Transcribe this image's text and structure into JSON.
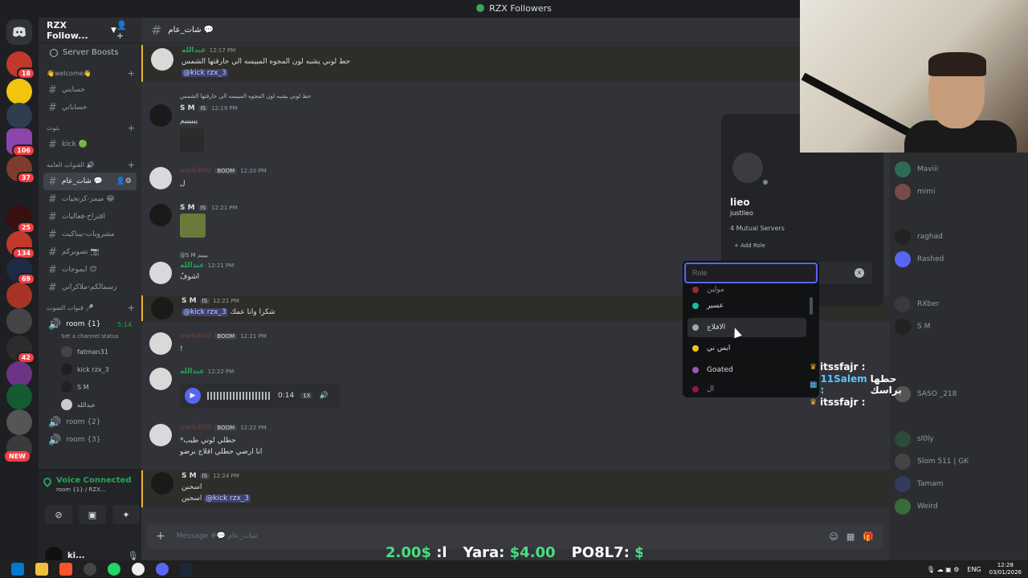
{
  "window": {
    "title": "RZX Followers"
  },
  "server": {
    "name": "RZX Follow...",
    "boost_label": "Server Boosts"
  },
  "rail": {
    "badges": [
      "18",
      "106",
      "37",
      "25",
      "134",
      "69",
      "42"
    ],
    "new_label": "NEW"
  },
  "sidebar": {
    "categories": [
      {
        "label": "👋welcome👋"
      },
      {
        "label": "بثوث"
      },
      {
        "label": "القنوات العامه 🔊"
      },
      {
        "label": "قنوات الصوت 🎤"
      }
    ],
    "channels": [
      {
        "label": "حسابتي"
      },
      {
        "label": "حساباتي"
      },
      {
        "label": "kick 🟢"
      },
      {
        "label": "شات_عام 💬"
      },
      {
        "label": "ميمز-كرنجيات 😂"
      },
      {
        "label": "اقتراح-فعاليات"
      },
      {
        "label": "مشروبات-بيناكيت"
      },
      {
        "label": "تصويركم 📷"
      },
      {
        "label": "ايموجات 😊"
      },
      {
        "label": "رسمالكم-ملاكراتي"
      }
    ],
    "voice_room": {
      "label": "room {1}",
      "timer": "5:14",
      "status": "Set a channel status"
    },
    "voice_users": [
      "fatman31",
      "kick rzx_3",
      "S M",
      "عبدالله"
    ],
    "voice_room2": "room {2}",
    "voice_room3": "room {3}"
  },
  "voice_panel": {
    "title": "Voice Connected",
    "subtitle": "room {1} / RZX..."
  },
  "user_panel": {
    "name": "ki..."
  },
  "chat": {
    "channel_name": "شات_عام 💬",
    "composer_placeholder": "Message #💬 شات_عام",
    "messages": [
      {
        "author": "عبدالله",
        "time": "12:17 PM",
        "text": "حط لوني يشبه لون المجوه المييسه الي حارقتها الشمس",
        "mention": "@kick rzx_3"
      },
      {
        "reply": "حط لوني يشبه لون المجوه المييسه الي حارقتها الشمس",
        "author": "S M",
        "tag": "IS",
        "time": "12:19 PM",
        "text": "ييييييم"
      },
      {
        "author": "aw6400",
        "tag": "BOOM",
        "time": "12:20 PM",
        "text": "ل"
      },
      {
        "author": "S M",
        "tag": "IS",
        "time": "12:21 PM"
      },
      {
        "reply": "@S M ييييم",
        "author": "عبدالله",
        "time": "12:21 PM",
        "text": "اشوفُ"
      },
      {
        "author": "S M",
        "tag": "IS",
        "time": "12:21 PM",
        "text": "شكرا وانا عمك",
        "mention": "@kick rzx_3"
      },
      {
        "author": "aw6400",
        "tag": "BOOM",
        "time": "12:21 PM",
        "text": "!"
      },
      {
        "author": "عبدالله",
        "time": "12:22 PM",
        "duration": "0:14",
        "speed": "1X"
      },
      {
        "author": "aw6400",
        "tag": "BOOM",
        "time": "12:22 PM",
        "text": "*حطلي لوني طيب",
        "text2": "انا ارضي حطلي اقلاج برضو"
      },
      {
        "author": "S M",
        "tag": "IS",
        "time": "12:24 PM",
        "text": "اسحبن",
        "text2": "اسحبن",
        "mention": "@kick rzx_3"
      }
    ]
  },
  "profile": {
    "display_name": "lieo",
    "username": "justlieo",
    "mutual": "4 Mutual Servers",
    "add_role": "Add Role"
  },
  "role_picker": {
    "placeholder": "Role",
    "roles": [
      {
        "label": "مولين",
        "color": "#f23f43"
      },
      {
        "label": "عسير",
        "color": "#1abc9c"
      },
      {
        "label": "الافلاج",
        "color": "#99aab5"
      },
      {
        "label": "ابس ني",
        "color": "#f1c40f"
      },
      {
        "label": "Goated",
        "color": "#9b59b6"
      },
      {
        "label": "ال",
        "color": "#e91e63"
      }
    ]
  },
  "members": [
    "Maviii",
    "mimi",
    "",
    "raghad",
    "Rashed",
    "",
    "RXber",
    "S M",
    "",
    "",
    "",
    "",
    "SASO _218",
    "",
    "sl0ly",
    "Slom 511 | GK",
    "Tamam",
    "Weird",
    "",
    ""
  ],
  "overlay": {
    "lines": [
      {
        "name": "itssfajr :",
        "message": ""
      },
      {
        "name": "11Salem :",
        "message": "حطها براسك"
      },
      {
        "name": "itssfajr :",
        "message": ""
      }
    ],
    "donations": [
      {
        "name": "ا:",
        "amount": "$2.00"
      },
      {
        "name": "Yara:",
        "amount": "$4.00"
      },
      {
        "name": "PO8L7:",
        "amount": "$"
      }
    ]
  },
  "taskbar": {
    "lang": "ENG",
    "time": "12:28",
    "date": "03/01/2026"
  }
}
